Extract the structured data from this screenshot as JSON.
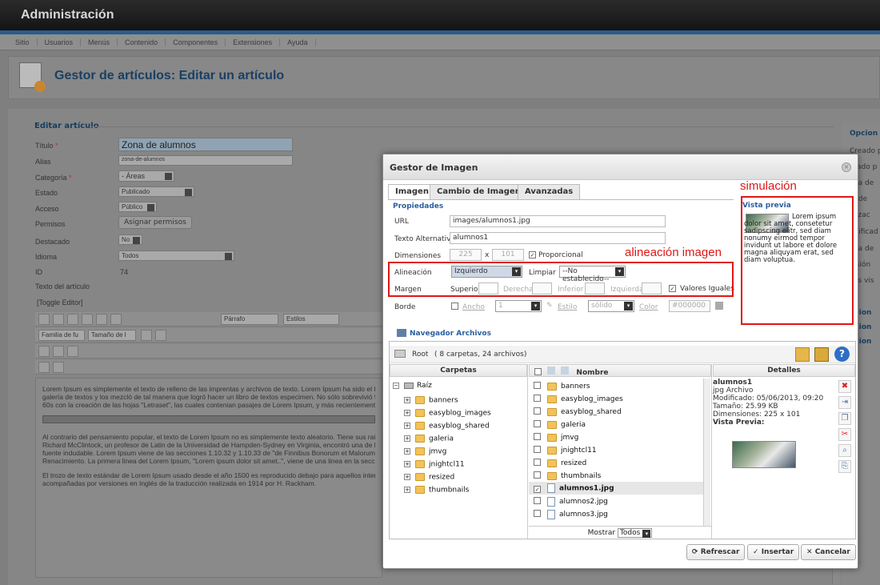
{
  "app": {
    "title": "Administración"
  },
  "menu": [
    "Sitio",
    "Usuarios",
    "Menús",
    "Contenido",
    "Componentes",
    "Extensiones",
    "Ayuda"
  ],
  "page": {
    "title": "Gestor de artículos: Editar un artículo"
  },
  "form": {
    "legend": "Editar artículo",
    "titulo_label": "Título",
    "titulo_value": "Zona de alumnos",
    "alias_label": "Alias",
    "alias_value": "zona-de-alumnos",
    "categoria_label": "Categoría",
    "categoria_value": "- Áreas",
    "estado_label": "Estado",
    "estado_value": "Publicado",
    "acceso_label": "Acceso",
    "acceso_value": "Público",
    "permisos_label": "Permisos",
    "permisos_button": "Asignar permisos",
    "destacado_label": "Destacado",
    "destacado_value": "No",
    "idioma_label": "Idioma",
    "idioma_value": "Todos",
    "id_label": "ID",
    "id_value": "74",
    "texto_label": "Texto del artículo",
    "toggle_editor": "[Toggle Editor]"
  },
  "editor_toolbar": {
    "parrafo": "Párrafo",
    "estilos": "Estilos",
    "familia": "Familia de fu",
    "tamano": "Tamaño de l"
  },
  "editor_text": {
    "p1": "Lorem Ipsum es simplemente el texto de relleno de las imprentas y archivos de texto. Lorem Ipsum ha sido el texto",
    "p2": "galería de textos y los mezcló de tal manera que logró hacer un libro de textos especimen. No sólo sobrevivió 500",
    "p3": "60s con la creación de las hojas \"Letraset\", las cuales contenian pasajes de Lorem Ipsum, y más recientemente co",
    "p4": "Al contrario del pensamiento popular, el texto de Lorem Ipsum no es simplemente texto aleatorio. Tiene sus raices e",
    "p5": "Richard McClintock, un profesor de Latin de la Universidad de Hampden-Sydney en Virginia, encontró una de las p",
    "p6": "fuente indudable. Lorem Ipsum viene de las secciones 1.10.32 y 1.10.33 de \"de Finnibus Bonorum et Malorum\" (Lo",
    "p7": "Renacimiento. La primera linea del Lorem Ipsum, \"Lorem ipsum dolor sit amet..\", viene de una linea en la sección 1",
    "p8": "El trozo de texto estándar de Lorem Ipsum usado desde el año 1500 es reproducido debajo para aquellos interesad",
    "p9": "acompañadas por versiones en Inglés de la traducción realizada en 1914 por H. Rackham."
  },
  "rightcol": [
    "Opcion",
    "Creado p",
    "reado p",
    "cha de",
    "io de",
    "alizac",
    "odificad",
    "cha de",
    "visión",
    "ces vis",
    "pcion",
    "pcion",
    "pcion"
  ],
  "modal": {
    "title": "Gestor de Imagen",
    "tabs": [
      "Imagen",
      "Cambio de Imagen",
      "Avanzadas"
    ],
    "propiedades": "Propiedades",
    "url_label": "URL",
    "url_value": "images/alumnos1.jpg",
    "alt_label": "Texto Alternativo",
    "alt_value": "alumnos1",
    "dim_label": "Dimensiones",
    "dim_w": "225",
    "dim_x": "x",
    "dim_h": "101",
    "proporcional": "Proporcional",
    "alineacion_label": "Alineación",
    "alineacion_value": "Izquierdo",
    "limpiar_label": "Limpiar",
    "limpiar_value": "--No establecido--",
    "margen_label": "Margen",
    "superior": "Superior",
    "derecha": "Derecha",
    "inferior": "Inferior",
    "izquierda": "Izquierda",
    "valores_iguales": "Valores Iguales",
    "borde_label": "Borde",
    "ancho": "Ancho",
    "ancho_value": "1",
    "estilo": "Estilo",
    "estilo_value": "sólido",
    "color": "Color",
    "color_value": "#000000",
    "vista_previa": "Vista previa",
    "preview_text": "Lorem ipsum dolor sit amet, consetetur sadipscing elitr, sed diam nonumy eirmod tempor invidunt ut labore et dolore magna aliquyam erat, sed diam voluptua.",
    "navegador": "Navegador Archivos",
    "root": "Root",
    "root_info": "( 8 carpetas, 24 archivos)",
    "carpetas": "Carpetas",
    "nombre": "Nombre",
    "detalles": "Detalles",
    "tree_root": "Raíz",
    "tree": [
      "banners",
      "easyblog_images",
      "easyblog_shared",
      "galeria",
      "jmvg",
      "jnightcl11",
      "resized",
      "thumbnails"
    ],
    "files": [
      "banners",
      "easyblog_images",
      "easyblog_shared",
      "galeria",
      "jmvg",
      "jnightcl11",
      "resized",
      "thumbnails",
      "alumnos1.jpg",
      "alumnos2.jpg",
      "alumnos3.jpg"
    ],
    "details": {
      "name": "alumnos1",
      "type": "jpg Archivo",
      "mod": "Modificado: 05/06/2013, 09:20",
      "size": "Tamaño: 25.99 KB",
      "dims": "Dimensiones: 225 x 101",
      "vista": "Vista Previa:"
    },
    "mostrar": "Mostrar",
    "mostrar_value": "Todos",
    "refrescar": "Refrescar",
    "insertar": "Insertar",
    "cancelar": "Cancelar"
  },
  "annotations": {
    "simulacion": "simulación",
    "alineacion": "alineación imagen"
  },
  "colors": {
    "annotation": "#e01616",
    "link": "#2b5ea1",
    "title": "#1a3f63"
  }
}
